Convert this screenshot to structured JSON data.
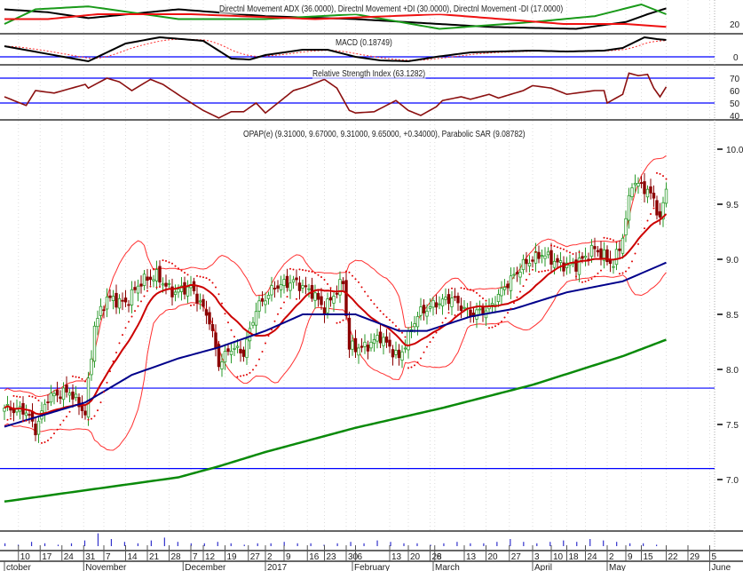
{
  "chart_data": {
    "type": "candlestick",
    "symbol_title": "OPAP(e) (9.31000, 9.67000, 9.31000, 9.65000, +0.34000), Parabolic SAR (9.08782)",
    "x_unit": "trading day index",
    "colors": {
      "up": "#2a9a2a",
      "down": "#8b0000",
      "sma20": "#cc0000",
      "sma50": "#00008b",
      "sma200": "#0a8a0a",
      "bands": "#ff3030",
      "sar": "#e00000",
      "hline": "#0000ff",
      "volume": "#3333cc"
    },
    "close_keypoints": [
      [
        0,
        7.65
      ],
      [
        7,
        7.62
      ],
      [
        10,
        7.45
      ],
      [
        14,
        7.75
      ],
      [
        21,
        7.8
      ],
      [
        26,
        7.6
      ],
      [
        29,
        8.4
      ],
      [
        33,
        8.65
      ],
      [
        39,
        8.6
      ],
      [
        44,
        8.8
      ],
      [
        49,
        8.85
      ],
      [
        54,
        8.7
      ],
      [
        60,
        8.75
      ],
      [
        66,
        8.45
      ],
      [
        69,
        8.05
      ],
      [
        73,
        8.2
      ],
      [
        77,
        8.15
      ],
      [
        81,
        8.55
      ],
      [
        87,
        8.75
      ],
      [
        93,
        8.8
      ],
      [
        99,
        8.7
      ],
      [
        103,
        8.55
      ],
      [
        109,
        8.8
      ],
      [
        111,
        8.2
      ],
      [
        116,
        8.2
      ],
      [
        121,
        8.3
      ],
      [
        127,
        8.1
      ],
      [
        133,
        8.5
      ],
      [
        139,
        8.6
      ],
      [
        144,
        8.65
      ],
      [
        150,
        8.5
      ],
      [
        156,
        8.55
      ],
      [
        161,
        8.75
      ],
      [
        167,
        8.95
      ],
      [
        173,
        9.05
      ],
      [
        179,
        8.95
      ],
      [
        184,
        8.95
      ],
      [
        190,
        9.1
      ],
      [
        196,
        8.95
      ],
      [
        199,
        9.2
      ],
      [
        202,
        9.7
      ],
      [
        206,
        9.65
      ],
      [
        209,
        9.55
      ],
      [
        211,
        9.35
      ],
      [
        213,
        9.65
      ]
    ],
    "sma50_keypoints": [
      [
        0,
        7.48
      ],
      [
        26,
        7.7
      ],
      [
        41,
        7.95
      ],
      [
        56,
        8.1
      ],
      [
        69,
        8.2
      ],
      [
        84,
        8.35
      ],
      [
        96,
        8.5
      ],
      [
        113,
        8.5
      ],
      [
        127,
        8.35
      ],
      [
        136,
        8.35
      ],
      [
        150,
        8.48
      ],
      [
        164,
        8.55
      ],
      [
        181,
        8.7
      ],
      [
        199,
        8.8
      ],
      [
        213,
        8.97
      ]
    ],
    "sma200_keypoints": [
      [
        0,
        6.8
      ],
      [
        56,
        7.02
      ],
      [
        69,
        7.12
      ],
      [
        84,
        7.25
      ],
      [
        113,
        7.47
      ],
      [
        141,
        7.65
      ],
      [
        170,
        7.86
      ],
      [
        199,
        8.12
      ],
      [
        213,
        8.27
      ]
    ],
    "horizontal_lines": [
      7.83,
      7.1
    ],
    "price_axis": {
      "ticks": [
        "10.0",
        "9.5",
        "9.0",
        "8.5",
        "8.0",
        "7.5",
        "7.0"
      ],
      "range": [
        6.55,
        10.2
      ]
    },
    "adx_panel": {
      "title": "Directnl Movement ADX (36.0000), Directnl Movement +DI (30.0000), Directnl Movement -DI (17.0000)",
      "tick": "20",
      "adx": [
        [
          0,
          35
        ],
        [
          14,
          32
        ],
        [
          27,
          26
        ],
        [
          56,
          35
        ],
        [
          84,
          28
        ],
        [
          113,
          25
        ],
        [
          156,
          17
        ],
        [
          184,
          15
        ],
        [
          200,
          22
        ],
        [
          207,
          30
        ],
        [
          213,
          36
        ]
      ],
      "plus_di": [
        [
          0,
          20
        ],
        [
          10,
          35
        ],
        [
          27,
          38
        ],
        [
          56,
          25
        ],
        [
          84,
          25
        ],
        [
          113,
          30
        ],
        [
          140,
          15
        ],
        [
          170,
          22
        ],
        [
          190,
          28
        ],
        [
          205,
          40
        ],
        [
          213,
          30
        ]
      ],
      "minus_di": [
        [
          0,
          25
        ],
        [
          14,
          25
        ],
        [
          30,
          30
        ],
        [
          60,
          30
        ],
        [
          100,
          25
        ],
        [
          140,
          30
        ],
        [
          160,
          25
        ],
        [
          180,
          20
        ],
        [
          200,
          20
        ],
        [
          213,
          17
        ]
      ]
    },
    "macd_panel": {
      "title": "MACD (0.18749)",
      "tick": "0",
      "macd": [
        [
          0,
          0.12
        ],
        [
          27,
          -0.05
        ],
        [
          39,
          0.15
        ],
        [
          50,
          0.22
        ],
        [
          64,
          0.18
        ],
        [
          73,
          -0.02
        ],
        [
          79,
          -0.03
        ],
        [
          84,
          0.02
        ],
        [
          96,
          0.08
        ],
        [
          104,
          0.08
        ],
        [
          113,
          0.0
        ],
        [
          121,
          -0.04
        ],
        [
          130,
          -0.05
        ],
        [
          139,
          0.0
        ],
        [
          150,
          0.05
        ],
        [
          159,
          0.06
        ],
        [
          170,
          0.07
        ],
        [
          181,
          0.06
        ],
        [
          193,
          0.07
        ],
        [
          199,
          0.1
        ],
        [
          206,
          0.22
        ],
        [
          210,
          0.2
        ],
        [
          213,
          0.19
        ]
      ]
    },
    "rsi_panel": {
      "title": "Relative Strength Index (63.1282)",
      "ticks": [
        "70",
        "60",
        "50",
        "40"
      ],
      "rsi": [
        [
          0,
          55
        ],
        [
          7,
          48
        ],
        [
          10,
          60
        ],
        [
          16,
          58
        ],
        [
          26,
          65
        ],
        [
          27,
          62
        ],
        [
          33,
          70
        ],
        [
          37,
          67
        ],
        [
          41,
          60
        ],
        [
          47,
          69
        ],
        [
          51,
          65
        ],
        [
          57,
          55
        ],
        [
          64,
          44
        ],
        [
          69,
          38
        ],
        [
          73,
          43
        ],
        [
          77,
          43
        ],
        [
          81,
          50
        ],
        [
          84,
          42
        ],
        [
          93,
          60
        ],
        [
          97,
          63
        ],
        [
          103,
          69
        ],
        [
          107,
          62
        ],
        [
          111,
          44
        ],
        [
          113,
          42
        ],
        [
          119,
          43
        ],
        [
          126,
          52
        ],
        [
          130,
          44
        ],
        [
          134,
          40
        ],
        [
          139,
          47
        ],
        [
          141,
          52
        ],
        [
          147,
          55
        ],
        [
          150,
          53
        ],
        [
          156,
          57
        ],
        [
          159,
          54
        ],
        [
          163,
          57
        ],
        [
          167,
          60
        ],
        [
          170,
          64
        ],
        [
          176,
          62
        ],
        [
          181,
          57
        ],
        [
          187,
          59
        ],
        [
          190,
          60
        ],
        [
          193,
          60
        ],
        [
          194,
          50
        ],
        [
          199,
          57
        ],
        [
          201,
          74
        ],
        [
          204,
          72
        ],
        [
          207,
          73
        ],
        [
          209,
          62
        ],
        [
          211,
          55
        ],
        [
          213,
          63
        ]
      ]
    },
    "volume_relative": [
      2,
      1,
      3,
      2,
      1,
      2,
      4,
      9,
      5,
      3,
      2,
      4,
      6,
      3,
      2,
      2,
      3,
      2,
      1,
      2,
      2,
      3,
      2,
      2,
      1,
      2,
      3,
      2,
      4,
      3,
      2,
      2,
      1,
      2,
      3,
      2,
      2,
      3,
      5,
      3,
      2,
      3,
      4,
      3,
      5,
      4,
      3,
      2,
      2,
      1
    ],
    "x_axis": {
      "day_ticks": [
        [
          "10",
          4.5
        ],
        [
          "17",
          11.5
        ],
        [
          "24",
          18.5
        ],
        [
          "31",
          25.5
        ],
        [
          "7",
          32
        ],
        [
          "14",
          39
        ],
        [
          "21",
          46
        ],
        [
          "28",
          53
        ],
        [
          "7",
          60
        ],
        [
          "12",
          64
        ],
        [
          "19",
          71
        ],
        [
          "27",
          78.5
        ],
        [
          "2",
          84
        ],
        [
          "9",
          90
        ],
        [
          "16",
          97.5
        ],
        [
          "23",
          103
        ],
        [
          "30",
          110
        ],
        [
          "6",
          113
        ],
        [
          "13",
          124
        ],
        [
          "20",
          130
        ],
        [
          "28",
          137
        ],
        [
          "6",
          138.5
        ],
        [
          "13",
          148
        ],
        [
          "20",
          155
        ],
        [
          "27",
          162.5
        ],
        [
          "3",
          170
        ],
        [
          "10",
          176
        ],
        [
          "18",
          181
        ],
        [
          "24",
          187
        ],
        [
          "2",
          194
        ],
        [
          "9",
          200
        ],
        [
          "15",
          205
        ],
        [
          "22",
          213
        ],
        [
          "29",
          220
        ],
        [
          "5",
          227
        ]
      ],
      "months": [
        [
          "ctober",
          0
        ],
        [
          "November",
          25.5
        ],
        [
          "December",
          57.5
        ],
        [
          "2017",
          84
        ],
        [
          "February",
          112
        ],
        [
          "March",
          138
        ],
        [
          "April",
          170
        ],
        [
          "May",
          194
        ],
        [
          "June",
          227
        ]
      ]
    }
  }
}
